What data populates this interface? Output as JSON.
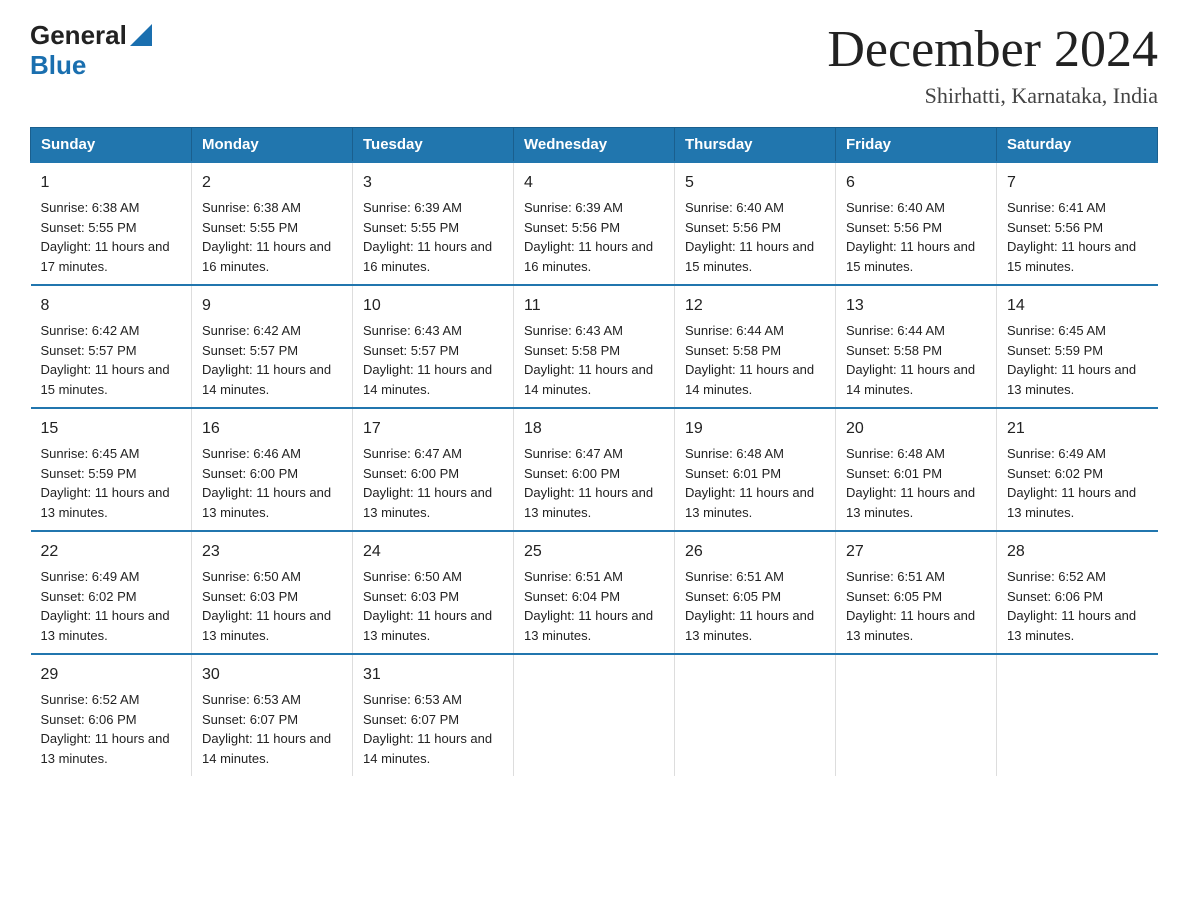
{
  "header": {
    "logo_general": "General",
    "logo_blue": "Blue",
    "title": "December 2024",
    "subtitle": "Shirhatti, Karnataka, India"
  },
  "days_of_week": [
    "Sunday",
    "Monday",
    "Tuesday",
    "Wednesday",
    "Thursday",
    "Friday",
    "Saturday"
  ],
  "weeks": [
    [
      {
        "day": "1",
        "sunrise": "6:38 AM",
        "sunset": "5:55 PM",
        "daylight": "11 hours and 17 minutes."
      },
      {
        "day": "2",
        "sunrise": "6:38 AM",
        "sunset": "5:55 PM",
        "daylight": "11 hours and 16 minutes."
      },
      {
        "day": "3",
        "sunrise": "6:39 AM",
        "sunset": "5:55 PM",
        "daylight": "11 hours and 16 minutes."
      },
      {
        "day": "4",
        "sunrise": "6:39 AM",
        "sunset": "5:56 PM",
        "daylight": "11 hours and 16 minutes."
      },
      {
        "day": "5",
        "sunrise": "6:40 AM",
        "sunset": "5:56 PM",
        "daylight": "11 hours and 15 minutes."
      },
      {
        "day": "6",
        "sunrise": "6:40 AM",
        "sunset": "5:56 PM",
        "daylight": "11 hours and 15 minutes."
      },
      {
        "day": "7",
        "sunrise": "6:41 AM",
        "sunset": "5:56 PM",
        "daylight": "11 hours and 15 minutes."
      }
    ],
    [
      {
        "day": "8",
        "sunrise": "6:42 AM",
        "sunset": "5:57 PM",
        "daylight": "11 hours and 15 minutes."
      },
      {
        "day": "9",
        "sunrise": "6:42 AM",
        "sunset": "5:57 PM",
        "daylight": "11 hours and 14 minutes."
      },
      {
        "day": "10",
        "sunrise": "6:43 AM",
        "sunset": "5:57 PM",
        "daylight": "11 hours and 14 minutes."
      },
      {
        "day": "11",
        "sunrise": "6:43 AM",
        "sunset": "5:58 PM",
        "daylight": "11 hours and 14 minutes."
      },
      {
        "day": "12",
        "sunrise": "6:44 AM",
        "sunset": "5:58 PM",
        "daylight": "11 hours and 14 minutes."
      },
      {
        "day": "13",
        "sunrise": "6:44 AM",
        "sunset": "5:58 PM",
        "daylight": "11 hours and 14 minutes."
      },
      {
        "day": "14",
        "sunrise": "6:45 AM",
        "sunset": "5:59 PM",
        "daylight": "11 hours and 13 minutes."
      }
    ],
    [
      {
        "day": "15",
        "sunrise": "6:45 AM",
        "sunset": "5:59 PM",
        "daylight": "11 hours and 13 minutes."
      },
      {
        "day": "16",
        "sunrise": "6:46 AM",
        "sunset": "6:00 PM",
        "daylight": "11 hours and 13 minutes."
      },
      {
        "day": "17",
        "sunrise": "6:47 AM",
        "sunset": "6:00 PM",
        "daylight": "11 hours and 13 minutes."
      },
      {
        "day": "18",
        "sunrise": "6:47 AM",
        "sunset": "6:00 PM",
        "daylight": "11 hours and 13 minutes."
      },
      {
        "day": "19",
        "sunrise": "6:48 AM",
        "sunset": "6:01 PM",
        "daylight": "11 hours and 13 minutes."
      },
      {
        "day": "20",
        "sunrise": "6:48 AM",
        "sunset": "6:01 PM",
        "daylight": "11 hours and 13 minutes."
      },
      {
        "day": "21",
        "sunrise": "6:49 AM",
        "sunset": "6:02 PM",
        "daylight": "11 hours and 13 minutes."
      }
    ],
    [
      {
        "day": "22",
        "sunrise": "6:49 AM",
        "sunset": "6:02 PM",
        "daylight": "11 hours and 13 minutes."
      },
      {
        "day": "23",
        "sunrise": "6:50 AM",
        "sunset": "6:03 PM",
        "daylight": "11 hours and 13 minutes."
      },
      {
        "day": "24",
        "sunrise": "6:50 AM",
        "sunset": "6:03 PM",
        "daylight": "11 hours and 13 minutes."
      },
      {
        "day": "25",
        "sunrise": "6:51 AM",
        "sunset": "6:04 PM",
        "daylight": "11 hours and 13 minutes."
      },
      {
        "day": "26",
        "sunrise": "6:51 AM",
        "sunset": "6:05 PM",
        "daylight": "11 hours and 13 minutes."
      },
      {
        "day": "27",
        "sunrise": "6:51 AM",
        "sunset": "6:05 PM",
        "daylight": "11 hours and 13 minutes."
      },
      {
        "day": "28",
        "sunrise": "6:52 AM",
        "sunset": "6:06 PM",
        "daylight": "11 hours and 13 minutes."
      }
    ],
    [
      {
        "day": "29",
        "sunrise": "6:52 AM",
        "sunset": "6:06 PM",
        "daylight": "11 hours and 13 minutes."
      },
      {
        "day": "30",
        "sunrise": "6:53 AM",
        "sunset": "6:07 PM",
        "daylight": "11 hours and 14 minutes."
      },
      {
        "day": "31",
        "sunrise": "6:53 AM",
        "sunset": "6:07 PM",
        "daylight": "11 hours and 14 minutes."
      },
      null,
      null,
      null,
      null
    ]
  ]
}
